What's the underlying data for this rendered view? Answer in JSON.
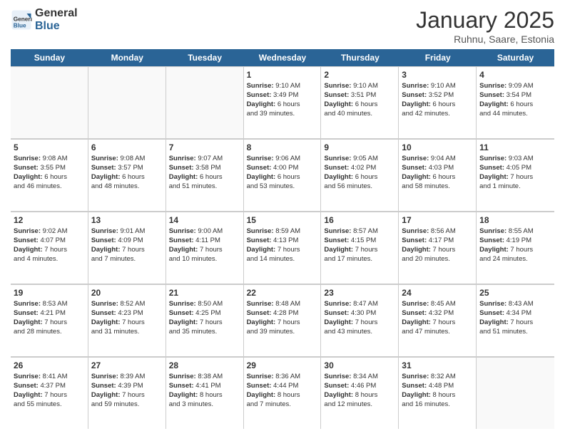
{
  "logo": {
    "general": "General",
    "blue": "Blue"
  },
  "title": "January 2025",
  "location": "Ruhnu, Saare, Estonia",
  "days_of_week": [
    "Sunday",
    "Monday",
    "Tuesday",
    "Wednesday",
    "Thursday",
    "Friday",
    "Saturday"
  ],
  "weeks": [
    [
      {
        "day": "",
        "info": "",
        "empty": true
      },
      {
        "day": "",
        "info": "",
        "empty": true
      },
      {
        "day": "",
        "info": "",
        "empty": true
      },
      {
        "day": "1",
        "info": "Sunrise: 9:10 AM\nSunset: 3:49 PM\nDaylight: 6 hours\nand 39 minutes."
      },
      {
        "day": "2",
        "info": "Sunrise: 9:10 AM\nSunset: 3:51 PM\nDaylight: 6 hours\nand 40 minutes."
      },
      {
        "day": "3",
        "info": "Sunrise: 9:10 AM\nSunset: 3:52 PM\nDaylight: 6 hours\nand 42 minutes."
      },
      {
        "day": "4",
        "info": "Sunrise: 9:09 AM\nSunset: 3:54 PM\nDaylight: 6 hours\nand 44 minutes."
      }
    ],
    [
      {
        "day": "5",
        "info": "Sunrise: 9:08 AM\nSunset: 3:55 PM\nDaylight: 6 hours\nand 46 minutes."
      },
      {
        "day": "6",
        "info": "Sunrise: 9:08 AM\nSunset: 3:57 PM\nDaylight: 6 hours\nand 48 minutes."
      },
      {
        "day": "7",
        "info": "Sunrise: 9:07 AM\nSunset: 3:58 PM\nDaylight: 6 hours\nand 51 minutes."
      },
      {
        "day": "8",
        "info": "Sunrise: 9:06 AM\nSunset: 4:00 PM\nDaylight: 6 hours\nand 53 minutes."
      },
      {
        "day": "9",
        "info": "Sunrise: 9:05 AM\nSunset: 4:02 PM\nDaylight: 6 hours\nand 56 minutes."
      },
      {
        "day": "10",
        "info": "Sunrise: 9:04 AM\nSunset: 4:03 PM\nDaylight: 6 hours\nand 58 minutes."
      },
      {
        "day": "11",
        "info": "Sunrise: 9:03 AM\nSunset: 4:05 PM\nDaylight: 7 hours\nand 1 minute."
      }
    ],
    [
      {
        "day": "12",
        "info": "Sunrise: 9:02 AM\nSunset: 4:07 PM\nDaylight: 7 hours\nand 4 minutes."
      },
      {
        "day": "13",
        "info": "Sunrise: 9:01 AM\nSunset: 4:09 PM\nDaylight: 7 hours\nand 7 minutes."
      },
      {
        "day": "14",
        "info": "Sunrise: 9:00 AM\nSunset: 4:11 PM\nDaylight: 7 hours\nand 10 minutes."
      },
      {
        "day": "15",
        "info": "Sunrise: 8:59 AM\nSunset: 4:13 PM\nDaylight: 7 hours\nand 14 minutes."
      },
      {
        "day": "16",
        "info": "Sunrise: 8:57 AM\nSunset: 4:15 PM\nDaylight: 7 hours\nand 17 minutes."
      },
      {
        "day": "17",
        "info": "Sunrise: 8:56 AM\nSunset: 4:17 PM\nDaylight: 7 hours\nand 20 minutes."
      },
      {
        "day": "18",
        "info": "Sunrise: 8:55 AM\nSunset: 4:19 PM\nDaylight: 7 hours\nand 24 minutes."
      }
    ],
    [
      {
        "day": "19",
        "info": "Sunrise: 8:53 AM\nSunset: 4:21 PM\nDaylight: 7 hours\nand 28 minutes."
      },
      {
        "day": "20",
        "info": "Sunrise: 8:52 AM\nSunset: 4:23 PM\nDaylight: 7 hours\nand 31 minutes."
      },
      {
        "day": "21",
        "info": "Sunrise: 8:50 AM\nSunset: 4:25 PM\nDaylight: 7 hours\nand 35 minutes."
      },
      {
        "day": "22",
        "info": "Sunrise: 8:48 AM\nSunset: 4:28 PM\nDaylight: 7 hours\nand 39 minutes."
      },
      {
        "day": "23",
        "info": "Sunrise: 8:47 AM\nSunset: 4:30 PM\nDaylight: 7 hours\nand 43 minutes."
      },
      {
        "day": "24",
        "info": "Sunrise: 8:45 AM\nSunset: 4:32 PM\nDaylight: 7 hours\nand 47 minutes."
      },
      {
        "day": "25",
        "info": "Sunrise: 8:43 AM\nSunset: 4:34 PM\nDaylight: 7 hours\nand 51 minutes."
      }
    ],
    [
      {
        "day": "26",
        "info": "Sunrise: 8:41 AM\nSunset: 4:37 PM\nDaylight: 7 hours\nand 55 minutes."
      },
      {
        "day": "27",
        "info": "Sunrise: 8:39 AM\nSunset: 4:39 PM\nDaylight: 7 hours\nand 59 minutes."
      },
      {
        "day": "28",
        "info": "Sunrise: 8:38 AM\nSunset: 4:41 PM\nDaylight: 8 hours\nand 3 minutes."
      },
      {
        "day": "29",
        "info": "Sunrise: 8:36 AM\nSunset: 4:44 PM\nDaylight: 8 hours\nand 7 minutes."
      },
      {
        "day": "30",
        "info": "Sunrise: 8:34 AM\nSunset: 4:46 PM\nDaylight: 8 hours\nand 12 minutes."
      },
      {
        "day": "31",
        "info": "Sunrise: 8:32 AM\nSunset: 4:48 PM\nDaylight: 8 hours\nand 16 minutes."
      },
      {
        "day": "",
        "info": "",
        "empty": true
      }
    ]
  ]
}
